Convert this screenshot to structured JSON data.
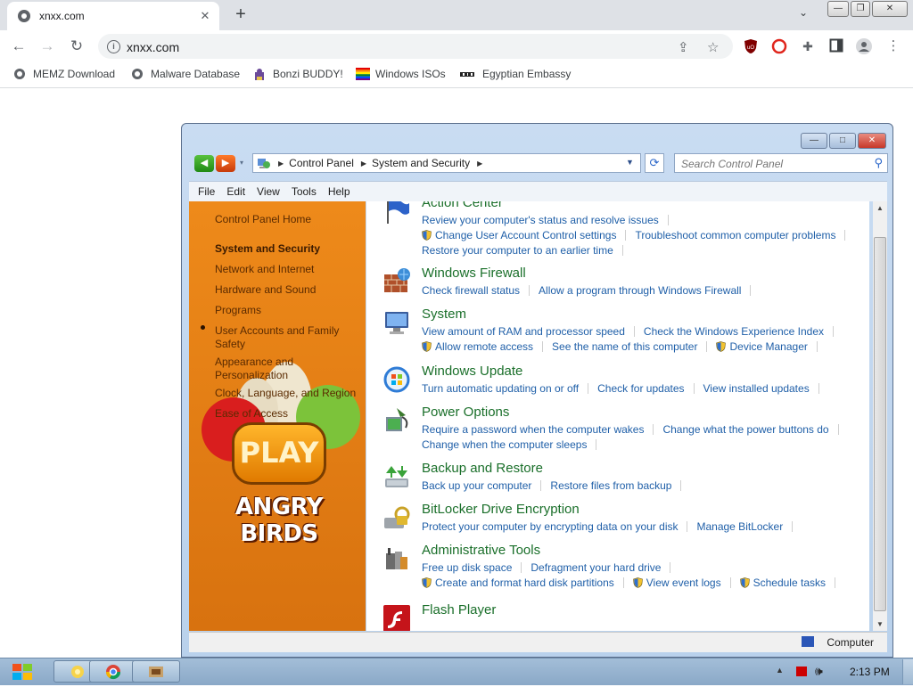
{
  "browser": {
    "tab_title": "xnxx.com",
    "tab_close": "✕",
    "new_tab": "+",
    "tab_search": "⌄",
    "url": "xnxx.com",
    "window_controls": [
      "—",
      "❐",
      "✕"
    ],
    "bookmarks": [
      "MEMZ Download",
      "Malware Database",
      "Bonzi BUDDY!",
      "Windows ISOs",
      "Egyptian Embassy"
    ]
  },
  "explorer": {
    "window_controls": [
      "—",
      "□",
      "✕"
    ],
    "breadcrumb": [
      "Control Panel",
      "System and Security"
    ],
    "search_placeholder": "Search Control Panel",
    "menu": [
      "File",
      "Edit",
      "View",
      "Tools",
      "Help"
    ],
    "nav": {
      "home": "Control Panel Home",
      "items": [
        "System and Security",
        "Network and Internet",
        "Hardware and Sound",
        "Programs",
        "User Accounts and Family Safety",
        "Appearance and Personalization",
        "Clock, Language, and Region",
        "Ease of Access"
      ]
    },
    "ad": {
      "button": "PLAY",
      "title": "ANGRY BIRDS"
    },
    "sections": [
      {
        "title": "Action Center",
        "icon": "flag-icon",
        "rows": [
          [
            {
              "t": "Review your computer's status and resolve issues"
            }
          ],
          [
            {
              "t": "Change User Account Control settings",
              "s": true
            },
            {
              "t": "Troubleshoot common computer problems"
            }
          ],
          [
            {
              "t": "Restore your computer to an earlier time"
            }
          ]
        ]
      },
      {
        "title": "Windows Firewall",
        "icon": "firewall-icon",
        "rows": [
          [
            {
              "t": "Check firewall status"
            },
            {
              "t": "Allow a program through Windows Firewall"
            }
          ]
        ]
      },
      {
        "title": "System",
        "icon": "system-icon",
        "rows": [
          [
            {
              "t": "View amount of RAM and processor speed"
            },
            {
              "t": "Check the Windows Experience Index"
            }
          ],
          [
            {
              "t": "Allow remote access",
              "s": true
            },
            {
              "t": "See the name of this computer"
            },
            {
              "t": "Device Manager",
              "s": true
            }
          ]
        ]
      },
      {
        "title": "Windows Update",
        "icon": "windows-update-icon",
        "rows": [
          [
            {
              "t": "Turn automatic updating on or off"
            },
            {
              "t": "Check for updates"
            },
            {
              "t": "View installed updates"
            }
          ]
        ]
      },
      {
        "title": "Power Options",
        "icon": "power-options-icon",
        "rows": [
          [
            {
              "t": "Require a password when the computer wakes"
            },
            {
              "t": "Change what the power buttons do"
            }
          ],
          [
            {
              "t": "Change when the computer sleeps"
            }
          ]
        ]
      },
      {
        "title": "Backup and Restore",
        "icon": "backup-icon",
        "rows": [
          [
            {
              "t": "Back up your computer"
            },
            {
              "t": "Restore files from backup"
            }
          ]
        ]
      },
      {
        "title": "BitLocker Drive Encryption",
        "icon": "bitlocker-icon",
        "rows": [
          [
            {
              "t": "Protect your computer by encrypting data on your disk"
            },
            {
              "t": "Manage BitLocker"
            }
          ]
        ]
      },
      {
        "title": "Administrative Tools",
        "icon": "admin-tools-icon",
        "rows": [
          [
            {
              "t": "Free up disk space"
            },
            {
              "t": "Defragment your hard drive"
            }
          ],
          [
            {
              "t": "Create and format hard disk partitions",
              "s": true
            },
            {
              "t": "View event logs",
              "s": true
            },
            {
              "t": "Schedule tasks",
              "s": true
            }
          ]
        ]
      },
      {
        "title": "Flash Player",
        "icon": "flash-player-icon",
        "rows": []
      }
    ],
    "status": "Computer"
  },
  "taskbar": {
    "clock": "2:13 PM"
  }
}
